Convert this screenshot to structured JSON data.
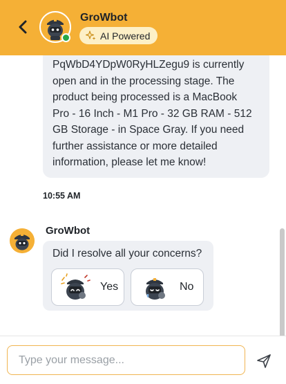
{
  "header": {
    "bot_name": "GroWbot",
    "badge_label": "AI Powered",
    "online": true,
    "colors": {
      "background": "#f5b036",
      "badge": "#fdf0c7",
      "online_dot": "#28a745"
    }
  },
  "messages": [
    {
      "type": "bot_text",
      "lines": [
        "PqWbD4YDpW0RyHLZegu9 is currently",
        "open and in the processing stage. The",
        "product being processed is a MacBook",
        "Pro - 16 Inch - M1 Pro - 32 GB RAM - 512",
        "GB Storage - in Space Gray. If you need",
        "further assistance or more detailed",
        "information, please let me know!"
      ],
      "time": "10:55 AM"
    },
    {
      "type": "bot_feedback",
      "sender": "GroWbot",
      "question": "Did I resolve all your concerns?",
      "options": [
        {
          "label": "Yes",
          "icon": "happy-bot-icon"
        },
        {
          "label": "No",
          "icon": "sad-bot-icon"
        }
      ]
    }
  ],
  "composer": {
    "placeholder": "Type your message...",
    "value": "",
    "send_icon": "send-icon"
  }
}
